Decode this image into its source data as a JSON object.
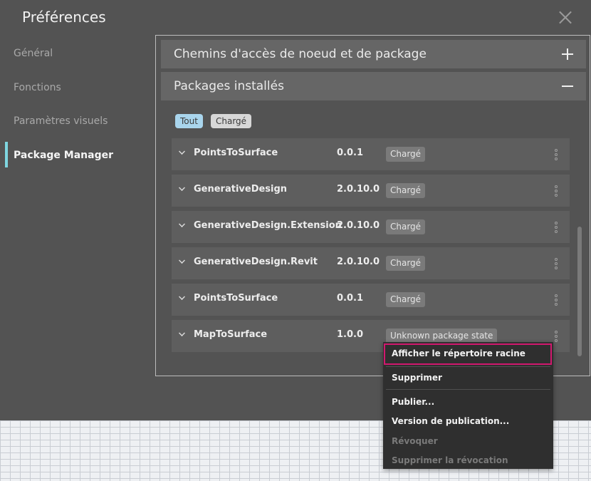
{
  "dialog": {
    "title": "Préférences"
  },
  "nav": {
    "items": [
      {
        "label": "Général"
      },
      {
        "label": "Fonctions"
      },
      {
        "label": "Paramètres visuels"
      },
      {
        "label": "Package Manager"
      }
    ],
    "active_index": 3
  },
  "sections": {
    "paths_header": "Chemins d'accès de noeud et de package",
    "installed_header": "Packages installés"
  },
  "filters": {
    "all": "Tout",
    "loaded": "Chargé"
  },
  "packages": [
    {
      "name": "PointsToSurface",
      "version": "0.0.1",
      "status": "Chargé"
    },
    {
      "name": "GenerativeDesign",
      "version": "2.0.10.0",
      "status": "Chargé"
    },
    {
      "name": "GenerativeDesign.Extension",
      "version": "2.0.10.0",
      "status": "Chargé"
    },
    {
      "name": "GenerativeDesign.Revit",
      "version": "2.0.10.0",
      "status": "Chargé"
    },
    {
      "name": "PointsToSurface",
      "version": "0.0.1",
      "status": "Chargé"
    },
    {
      "name": "MapToSurface",
      "version": "1.0.0",
      "status": "Unknown package state"
    }
  ],
  "context_menu": {
    "show_root": "Afficher le répertoire racine",
    "delete": "Supprimer",
    "publish": "Publier...",
    "publish_version": "Version de publication...",
    "deprecate": "Révoquer",
    "undeprecate": "Supprimer la révocation"
  },
  "colors": {
    "accent_highlight": "#d1186e",
    "nav_indicator": "#7fd6e0",
    "filter_active": "#a9d5ed"
  }
}
